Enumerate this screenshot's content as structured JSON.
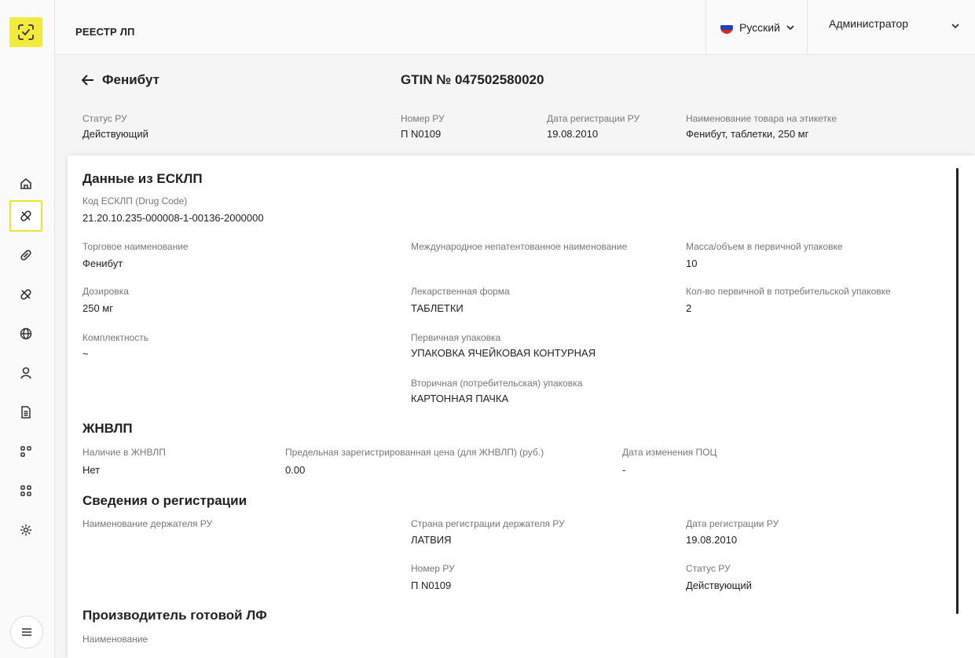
{
  "topbar": {
    "title": "РЕЕСТР ЛП",
    "language": "Русский",
    "user": "Администратор"
  },
  "header": {
    "back_label": "Фенибут",
    "gtin": "GTIN  № 047502580020",
    "fields": {
      "status_label": "Статус РУ",
      "status_value": "Действующий",
      "ru_number_label": "Номер РУ",
      "ru_number_value": "П N0109",
      "reg_date_label": "Дата регистрации РУ",
      "reg_date_value": "19.08.2010",
      "label_name_label": "Наименование товара на этикетке",
      "label_name_value": "Фенибут, таблетки, 250 мг"
    }
  },
  "esklp": {
    "title": "Данные из ЕСКЛП",
    "code_label": "Код ЕСКЛП (Drug Code)",
    "code_value": "21.20.10.235-000008-1-00136-2000000",
    "trade_name_label": "Торговое наименование",
    "trade_name_value": "Фенибут",
    "inn_label": "Международное непатентованное наименование",
    "mass_label": "Масса/объем в первичной упаковке",
    "mass_value": "10",
    "dosage_label": "Дозировка",
    "dosage_value": "250 мг",
    "form_label": "Лекарственная форма",
    "form_value": "ТАБЛЕТКИ",
    "qty_label": "Кол-во первичной в потребительской упаковке",
    "qty_value": "2",
    "completeness_label": "Комплектность",
    "completeness_value": "~",
    "primary_pack_label": "Первичная упаковка",
    "primary_pack_value": "УПАКОВКА ЯЧЕЙКОВАЯ КОНТУРНАЯ",
    "secondary_pack_label": "Вторичная (потребительская) упаковка",
    "secondary_pack_value": "КАРТОННАЯ ПАЧКА"
  },
  "zhnvlp": {
    "title": "ЖНВЛП",
    "presence_label": "Наличие в ЖНВЛП",
    "presence_value": "Нет",
    "price_label": "Предельная зарегистрированная цена (для ЖНВЛП) (руб.)",
    "price_value": "0.00",
    "change_date_label": "Дата изменения ПОЦ",
    "change_date_value": "-"
  },
  "registration": {
    "title": "Сведения о регистрации",
    "holder_label": "Наименование держателя РУ",
    "country_label": "Страна регистрации держателя РУ",
    "country_value": "ЛАТВИЯ",
    "reg_date_label": "Дата регистрации РУ",
    "reg_date_value": "19.08.2010",
    "number_label": "Номер РУ",
    "number_value": "П N0109",
    "status_label": "Статус РУ",
    "status_value": "Действующий"
  },
  "manufacturer": {
    "title": "Производитель готовой ЛФ",
    "name_label": "Наименование"
  },
  "colors": {
    "accent": "#f2ea3c",
    "text": "#222222",
    "muted": "#777777"
  }
}
